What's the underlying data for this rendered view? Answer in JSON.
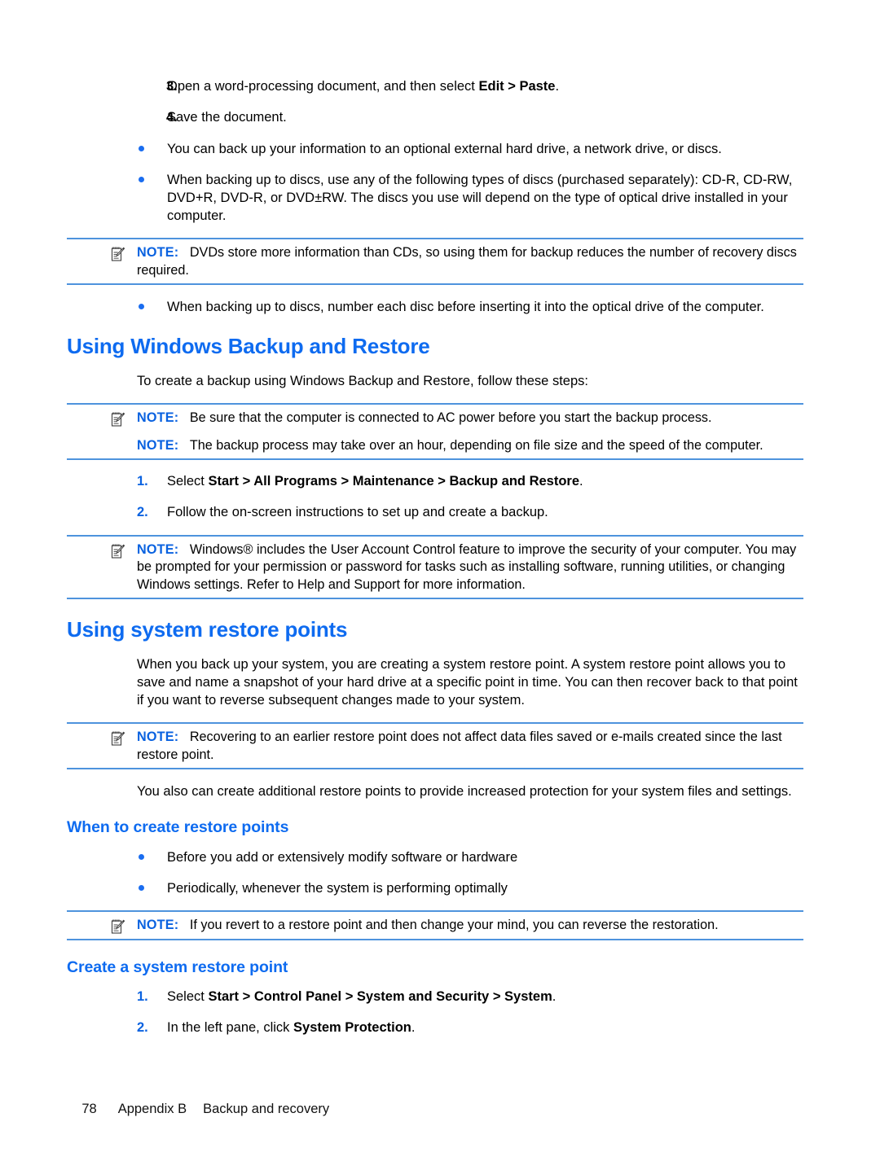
{
  "document": {
    "steps_top": [
      {
        "num": "3.",
        "num_color": "black",
        "text_before": "Open a word-processing document, and then select ",
        "bold": "Edit > Paste",
        "text_after": "."
      },
      {
        "num": "4.",
        "num_color": "black",
        "text_before": "Save the document.",
        "bold": "",
        "text_after": ""
      }
    ],
    "bullets_top": [
      "You can back up your information to an optional external hard drive, a network drive, or discs.",
      "When backing up to discs, use any of the following types of discs (purchased separately): CD-R, CD-RW, DVD+R, DVD-R, or DVD±RW. The discs you use will depend on the type of optical drive installed in your computer."
    ],
    "note_1": {
      "label": "NOTE:",
      "text": "DVDs store more information than CDs, so using them for backup reduces the number of recovery discs required."
    },
    "bullet_after_note_1": "When backing up to discs, number each disc before inserting it into the optical drive of the computer.",
    "heading_1": "Using Windows Backup and Restore",
    "intro_1": "To create a backup using Windows Backup and Restore, follow these steps:",
    "note_2a": {
      "label": "NOTE:",
      "text": "Be sure that the computer is connected to AC power before you start the backup process."
    },
    "note_2b": {
      "label": "NOTE:",
      "text": "The backup process may take over an hour, depending on file size and the speed of the computer."
    },
    "steps_backup": [
      {
        "num": "1.",
        "num_color": "blue",
        "text_before": "Select ",
        "bold": "Start > All Programs > Maintenance > Backup and Restore",
        "text_after": "."
      },
      {
        "num": "2.",
        "num_color": "blue",
        "text_before": "Follow the on-screen instructions to set up and create a backup.",
        "bold": "",
        "text_after": ""
      }
    ],
    "note_3": {
      "label": "NOTE:",
      "text": "Windows® includes the User Account Control feature to improve the security of your computer. You may be prompted for your permission or password for tasks such as installing software, running utilities, or changing Windows settings. Refer to Help and Support for more information."
    },
    "heading_2": "Using system restore points",
    "para_restore": "When you back up your system, you are creating a system restore point. A system restore point allows you to save and name a snapshot of your hard drive at a specific point in time. You can then recover back to that point if you want to reverse subsequent changes made to your system.",
    "note_4": {
      "label": "NOTE:",
      "text": "Recovering to an earlier restore point does not affect data files saved or e-mails created since the last restore point."
    },
    "para_additional": "You also can create additional restore points to provide increased protection for your system files and settings.",
    "heading_3": "When to create restore points",
    "bullets_when": [
      "Before you add or extensively modify software or hardware",
      "Periodically, whenever the system is performing optimally"
    ],
    "note_5": {
      "label": "NOTE:",
      "text": "If you revert to a restore point and then change your mind, you can reverse the restoration."
    },
    "heading_4": "Create a system restore point",
    "steps_create": [
      {
        "num": "1.",
        "num_color": "blue",
        "text_before": "Select ",
        "bold": "Start > Control Panel > System and Security > System",
        "text_after": "."
      },
      {
        "num": "2.",
        "num_color": "blue",
        "text_before": "In the left pane, click ",
        "bold": "System Protection",
        "text_after": "."
      }
    ],
    "footer": {
      "page_number": "78",
      "appendix": "Appendix B",
      "title": "Backup and recovery"
    },
    "colors": {
      "heading_blue": "#0e6bf0",
      "note_label_blue": "#0a62e0",
      "note_rule_blue": "#4e93dd",
      "bullet_blue": "#1a6df0",
      "number_blue": "#0a62e0",
      "body_black": "#000000"
    },
    "icons": {
      "note": "notepad-pencil-icon"
    }
  }
}
